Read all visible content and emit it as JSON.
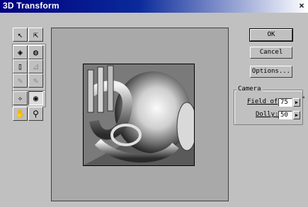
{
  "window": {
    "title": "3D Transform",
    "close_glyph": "×"
  },
  "tools": {
    "row1": [
      {
        "name": "direct-selection-icon",
        "glyph": "➤"
      },
      {
        "name": "convert-anchor-icon",
        "glyph": "⇱"
      }
    ],
    "row2": [
      {
        "name": "cube-tool-icon",
        "glyph": "◈"
      },
      {
        "name": "sphere-tool-icon",
        "glyph": "◍"
      }
    ],
    "row3": [
      {
        "name": "cylinder-tool-icon",
        "glyph": "▯"
      },
      {
        "name": "delete-anchor-icon",
        "glyph": "⊿"
      }
    ],
    "row4": [
      {
        "name": "add-point-icon",
        "glyph": "✎"
      },
      {
        "name": "remove-point-icon",
        "glyph": "✎"
      }
    ],
    "row5": [
      {
        "name": "pan-camera-icon",
        "glyph": "◈"
      },
      {
        "name": "trackball-icon",
        "glyph": "◉"
      }
    ],
    "row6": [
      {
        "name": "hand-icon",
        "glyph": "✋"
      },
      {
        "name": "zoom-icon",
        "glyph": "🔍"
      }
    ]
  },
  "buttons": {
    "ok": "OK",
    "cancel": "Cancel",
    "options": "Options..."
  },
  "camera": {
    "group_label": "Camera",
    "field_of_view_label": "Field of",
    "field_of_view_value": "75",
    "field_of_view_unit": "°",
    "dolly_label": "Dolly:",
    "dolly_value": "50",
    "spin_glyph": "▶"
  }
}
